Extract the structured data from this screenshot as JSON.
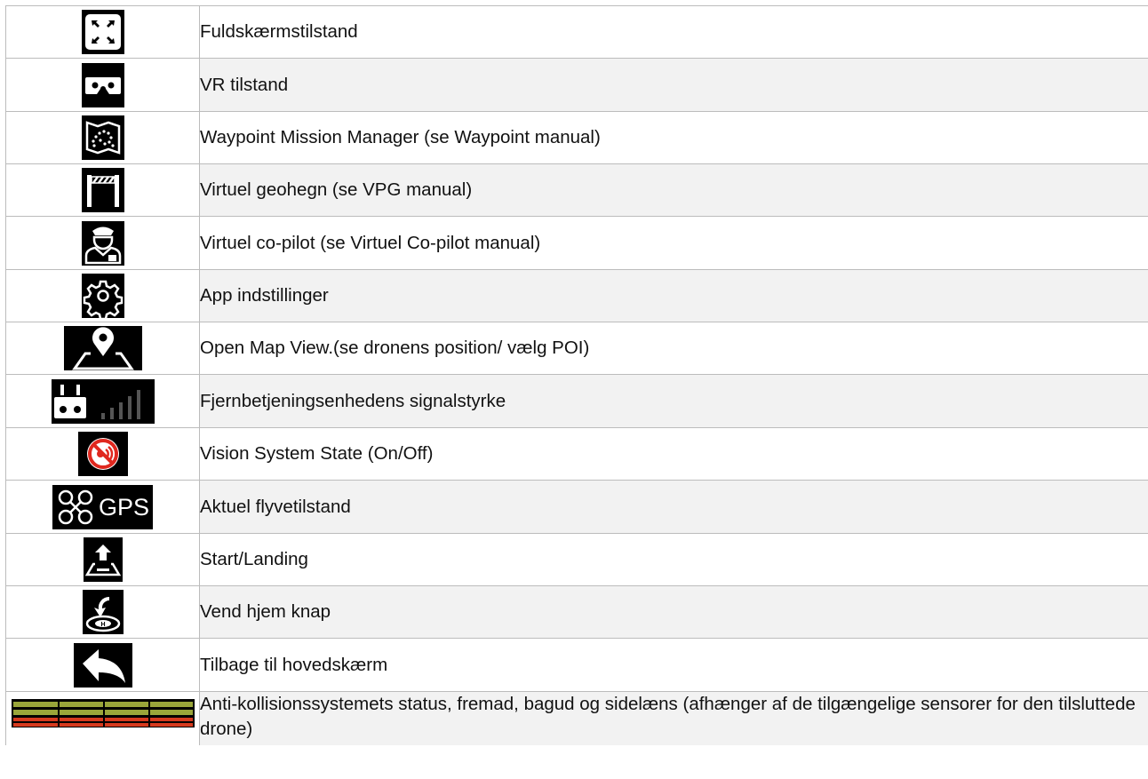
{
  "rows": [
    {
      "icon": "fullscreen-icon",
      "label": "Fuldskærmstilstand"
    },
    {
      "icon": "vr-headset-icon",
      "label": "VR tilstand"
    },
    {
      "icon": "waypoint-map-icon",
      "label": "Waypoint Mission Manager (se Waypoint manual)"
    },
    {
      "icon": "geofence-barrier-icon",
      "label": "Virtuel geohegn (se VPG manual)"
    },
    {
      "icon": "pilot-icon",
      "label": "Virtuel co-pilot (se Virtuel Co-pilot manual)"
    },
    {
      "icon": "gear-icon",
      "label": "App indstillinger"
    },
    {
      "icon": "map-pin-icon",
      "label": "Open Map View.(se dronens position/ vælg POI)"
    },
    {
      "icon": "remote-signal-icon",
      "label": "Fjernbetjeningsenhedens signalstyrke"
    },
    {
      "icon": "vision-off-icon",
      "label": "Vision System State (On/Off)"
    },
    {
      "icon": "drone-gps-icon",
      "label": "Aktuel flyvetilstand",
      "icon_text": "GPS"
    },
    {
      "icon": "takeoff-icon",
      "label": "Start/Landing"
    },
    {
      "icon": "return-home-icon",
      "label": "Vend hjem knap"
    },
    {
      "icon": "back-arrow-icon",
      "label": "Tilbage til hovedskærm"
    },
    {
      "icon": "collision-bars-icon",
      "label": "Anti-kollisionssystemets status, fremad, bagud og sidelæns (afhænger af de tilgængelige sensorer for den tilsluttede drone)"
    }
  ],
  "colors": {
    "icon_bg": "#000000",
    "border": "#bcbcbc",
    "alt_row": "#f2f2f2",
    "vision_red": "#e0281f",
    "bar_green": "#9aa63a",
    "bar_red": "#d63a1e"
  }
}
